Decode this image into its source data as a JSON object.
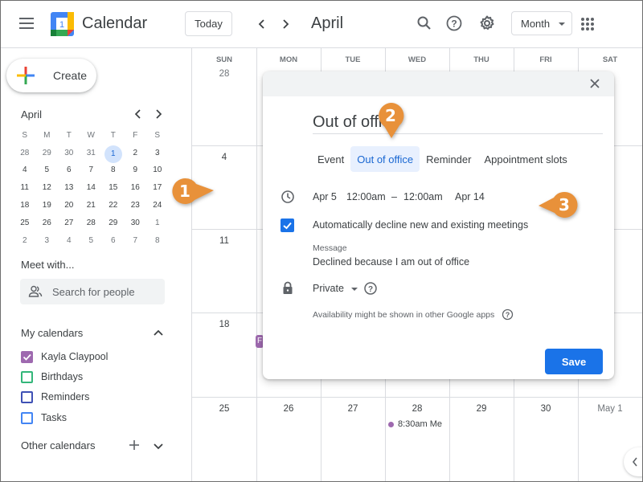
{
  "header": {
    "menu_icon": "hamburger-menu-icon",
    "app_title": "Calendar",
    "logo_day": "1",
    "today_label": "Today",
    "month_title": "April",
    "view_select": "Month",
    "icons": [
      "search-icon",
      "help-icon",
      "settings-gear-icon",
      "apps-grid-icon"
    ]
  },
  "sidebar": {
    "create_label": "Create",
    "mini_calendar": {
      "month": "April",
      "weekdays": [
        "S",
        "M",
        "T",
        "W",
        "T",
        "F",
        "S"
      ],
      "weeks": [
        [
          "28",
          "29",
          "30",
          "31",
          "1",
          "2",
          "3"
        ],
        [
          "4",
          "5",
          "6",
          "7",
          "8",
          "9",
          "10"
        ],
        [
          "11",
          "12",
          "13",
          "14",
          "15",
          "16",
          "17"
        ],
        [
          "18",
          "19",
          "20",
          "21",
          "22",
          "23",
          "24"
        ],
        [
          "25",
          "26",
          "27",
          "28",
          "29",
          "30",
          "1"
        ],
        [
          "2",
          "3",
          "4",
          "5",
          "6",
          "7",
          "8"
        ]
      ],
      "today": "1"
    },
    "meet_with_title": "Meet with...",
    "people_search_placeholder": "Search for people",
    "my_calendars_title": "My calendars",
    "my_calendars": [
      {
        "label": "Kayla Claypool",
        "checked": true,
        "color": "#9e69af"
      },
      {
        "label": "Birthdays",
        "checked": false,
        "color": "#33b679"
      },
      {
        "label": "Reminders",
        "checked": false,
        "color": "#3f51b5"
      },
      {
        "label": "Tasks",
        "checked": false,
        "color": "#4285f4"
      }
    ],
    "other_calendars_title": "Other calendars"
  },
  "grid": {
    "weekdays": [
      "SUN",
      "MON",
      "TUE",
      "WED",
      "THU",
      "FRI",
      "SAT"
    ],
    "first_col_days": [
      "28",
      "4",
      "11",
      "18",
      "25"
    ],
    "last_row_days": [
      "25",
      "26",
      "27",
      "28",
      "29",
      "30",
      "May 1"
    ],
    "events": [
      {
        "day": "28",
        "label": "8:30am Me",
        "color": "#9e69af"
      }
    ],
    "partial_chip_label": "F"
  },
  "dialog": {
    "title_value": "Out of office",
    "tabs": [
      {
        "label": "Event",
        "active": false
      },
      {
        "label": "Out of office",
        "active": true
      },
      {
        "label": "Reminder",
        "active": false
      },
      {
        "label": "Appointment slots",
        "active": false
      }
    ],
    "start_date": "Apr 5",
    "start_time": "12:00am",
    "dash": "–",
    "end_time": "12:00am",
    "end_date": "Apr 14",
    "auto_decline_label": "Automatically decline new and existing meetings",
    "auto_decline_checked": true,
    "message_label": "Message",
    "message_value": "Declined because I am out of office",
    "visibility": "Private",
    "availability_note": "Availability might be shown in other Google apps",
    "save_label": "Save"
  },
  "callouts": [
    "1",
    "2",
    "3"
  ],
  "colors": {
    "accent": "#1a73e8",
    "callout": "#e8913a",
    "active_tab_bg": "#e8f0fe"
  }
}
